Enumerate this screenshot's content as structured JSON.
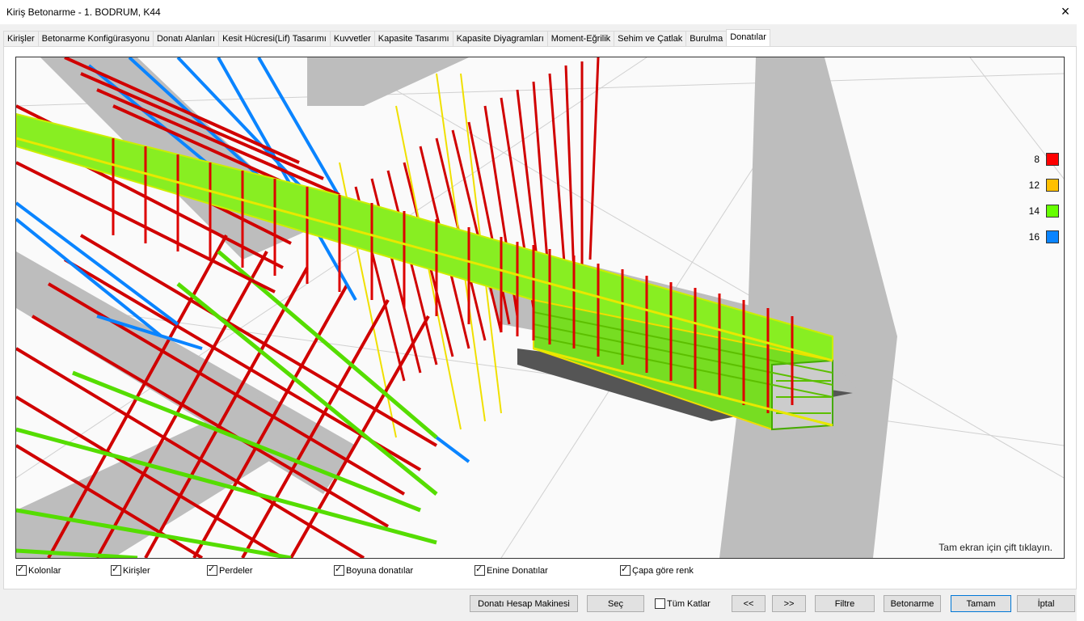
{
  "window": {
    "title": "Kiriş Betonarme - 1. BODRUM, K44",
    "close_icon": "×"
  },
  "tabs": [
    {
      "label": "Kirişler",
      "active": false
    },
    {
      "label": "Betonarme Konfigürasyonu",
      "active": false
    },
    {
      "label": "Donatı Alanları",
      "active": false
    },
    {
      "label": "Kesit Hücresi(Lif) Tasarımı",
      "active": false
    },
    {
      "label": "Kuvvetler",
      "active": false
    },
    {
      "label": "Kapasite Tasarımı",
      "active": false
    },
    {
      "label": "Kapasite Diyagramları",
      "active": false
    },
    {
      "label": "Moment-Eğrilik",
      "active": false
    },
    {
      "label": "Sehim ve Çatlak",
      "active": false
    },
    {
      "label": "Burulma",
      "active": false
    },
    {
      "label": "Donatılar",
      "active": true
    }
  ],
  "legend": [
    {
      "label": "8",
      "color": "#ff0000"
    },
    {
      "label": "12",
      "color": "#ffc000"
    },
    {
      "label": "14",
      "color": "#66ff00"
    },
    {
      "label": "16",
      "color": "#0a84ff"
    }
  ],
  "viewport": {
    "hint": "Tam ekran için çift tıklayın."
  },
  "checkboxes": [
    {
      "label": "Kolonlar",
      "checked": true
    },
    {
      "label": "Kirişler",
      "checked": true
    },
    {
      "label": "Perdeler",
      "checked": true
    },
    {
      "label": "Boyuna donatılar",
      "checked": true
    },
    {
      "label": "Enine Donatılar",
      "checked": true
    },
    {
      "label": "Çapa göre renk",
      "checked": true
    }
  ],
  "buttons": {
    "calculator": "Donatı Hesap Makinesi",
    "select": "Seç",
    "all_floors": "Tüm Katlar",
    "prev": "<<",
    "next": ">>",
    "filter": "Filtre",
    "concrete": "Betonarme",
    "ok": "Tamam",
    "cancel": "İptal"
  }
}
